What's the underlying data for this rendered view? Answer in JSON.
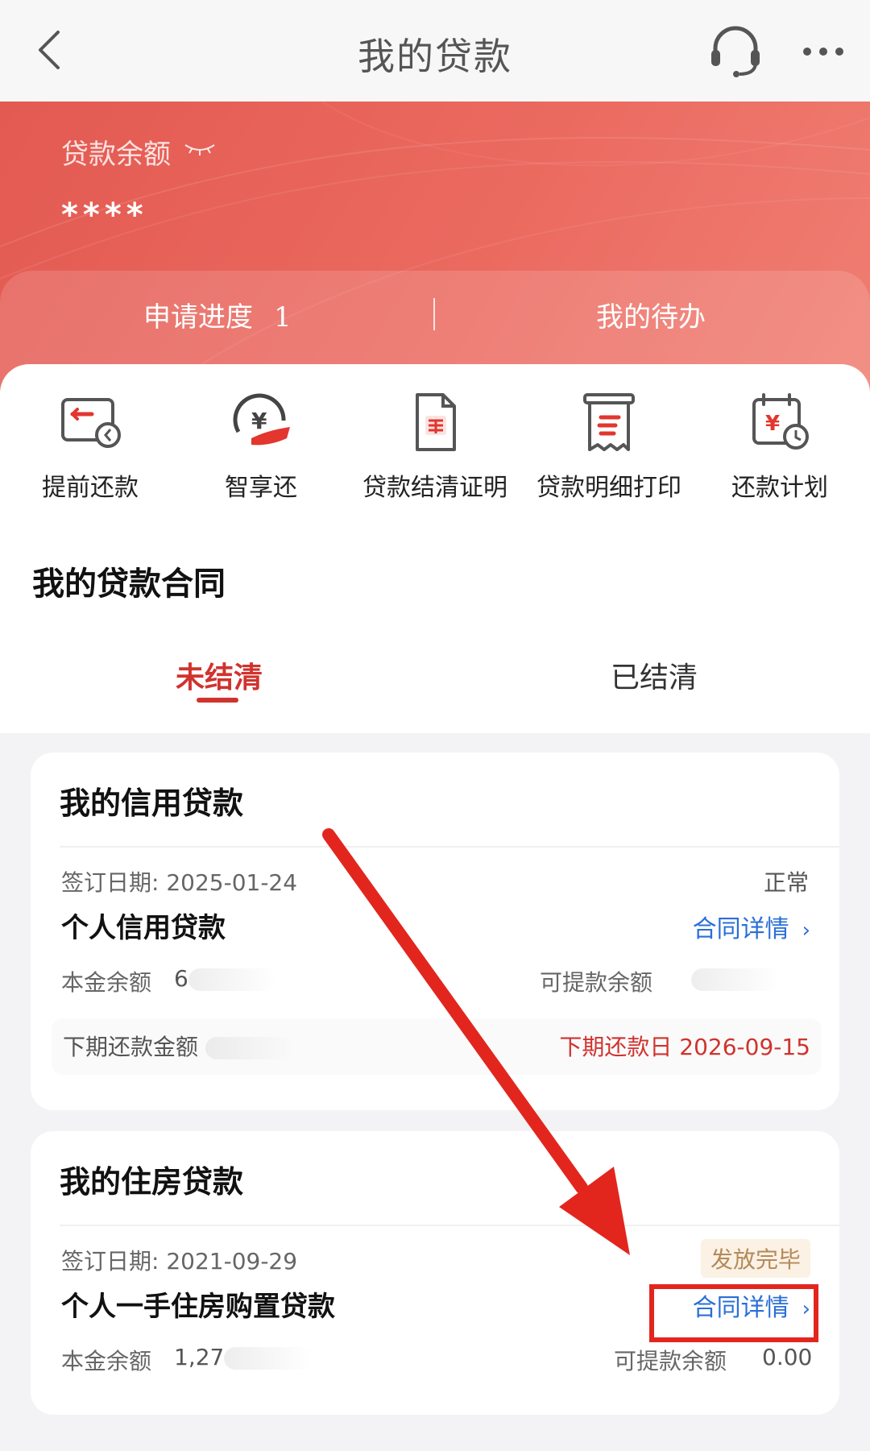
{
  "nav": {
    "title": "我的贷款",
    "icons": {
      "back": "back-arrow-icon",
      "service": "headset-icon",
      "more": "more-icon"
    }
  },
  "banner": {
    "balance_label": "贷款余额",
    "balance_value": "****",
    "apply_label": "申请进度",
    "apply_count": "1",
    "todo_label": "我的待办"
  },
  "quick_actions": [
    {
      "label": "提前还款",
      "icon": "early-repay-icon"
    },
    {
      "label": "智享还",
      "icon": "smart-repay-icon"
    },
    {
      "label": "贷款结清证明",
      "icon": "settlement-certificate-icon"
    },
    {
      "label": "贷款明细打印",
      "icon": "detail-print-icon"
    },
    {
      "label": "还款计划",
      "icon": "repayment-plan-icon"
    }
  ],
  "contracts": {
    "title": "我的贷款合同",
    "tabs": [
      {
        "label": "未结清",
        "active": true
      },
      {
        "label": "已结清",
        "active": false
      }
    ]
  },
  "credit_card": {
    "title": "我的信用贷款",
    "sign_date": "签订日期:  2025-01-24",
    "status": "正常",
    "loan_name": "个人信用贷款",
    "detail_link": "合同详情",
    "principal_label": "本金余额",
    "principal_value_visible": "6",
    "withdraw_label": "可提款余额",
    "next_amount_label": "下期还款金额",
    "next_date_text": "下期还款日 2026-09-15"
  },
  "house_card": {
    "title": "我的住房贷款",
    "sign_date": "签订日期:  2021-09-29",
    "status_badge": "发放完毕",
    "loan_name": "个人一手住房购置贷款",
    "detail_link": "合同详情",
    "principal_label": "本金余额",
    "principal_value_visible": "1,27",
    "withdraw_label": "可提款余额",
    "withdraw_value": "0.00"
  },
  "colors": {
    "brand_red": "#d0332e",
    "banner_red": "#e35a52",
    "link_blue": "#2a6fd6",
    "annotation_red": "#e2261e"
  }
}
